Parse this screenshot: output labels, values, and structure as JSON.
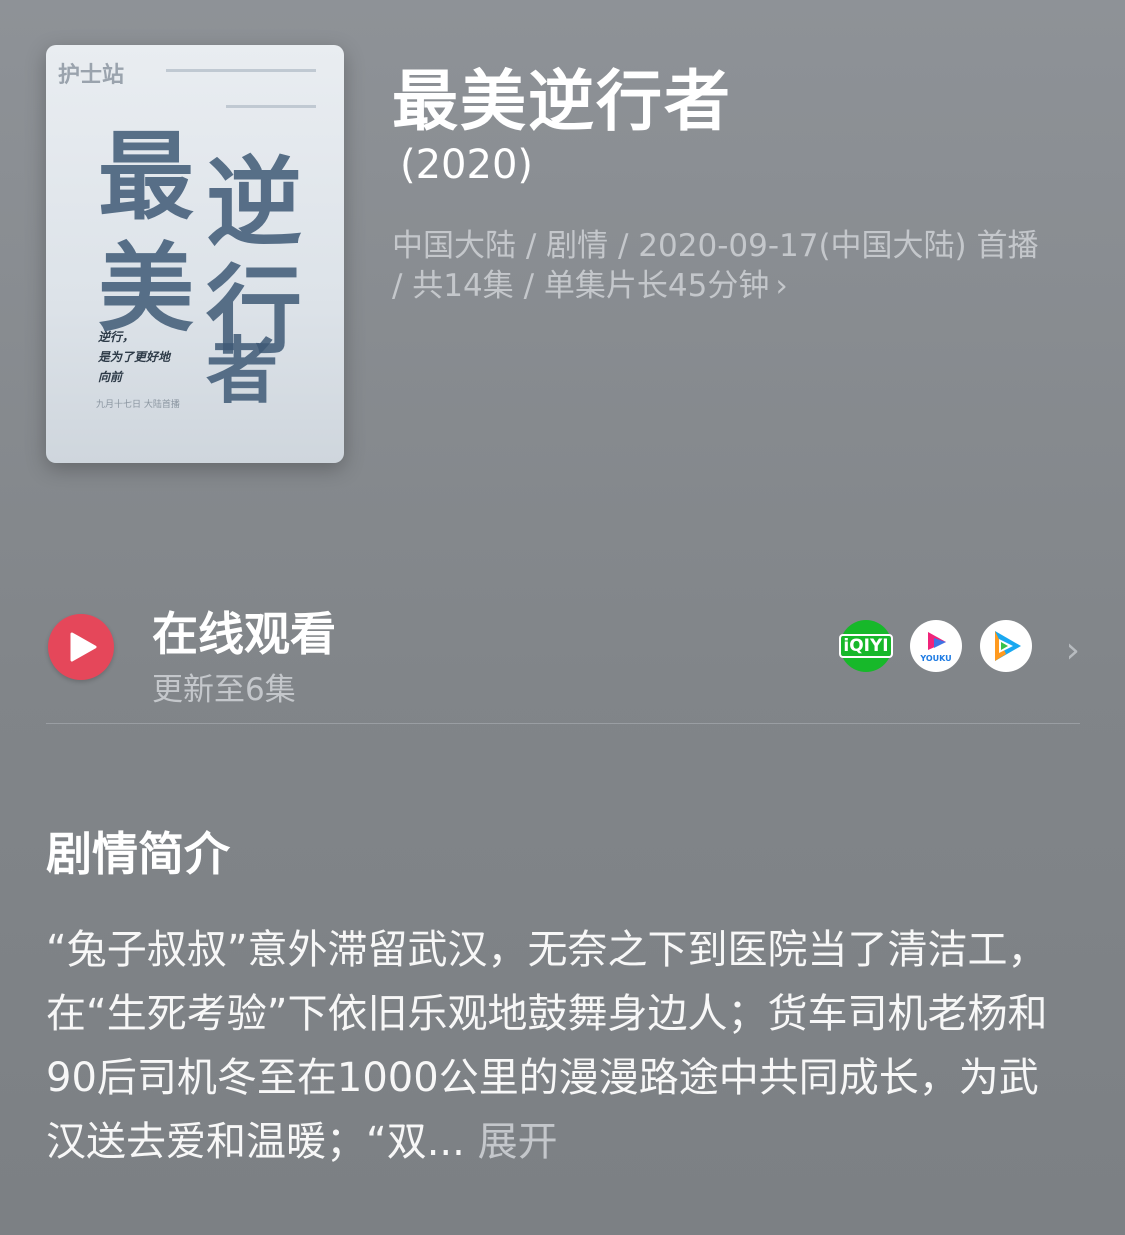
{
  "show": {
    "title": "最美逆行者",
    "year": "(2020)",
    "meta": "中国大陆 / 剧情 / 2020-09-17(中国大陆) 首播 / 共14集 / 单集片长45分钟",
    "meta_chevron": "›"
  },
  "poster": {
    "top_text": "护士站",
    "big_chars": [
      "最",
      "逆",
      "美",
      "行",
      "者"
    ],
    "tagline": "逆行，\n是为了更好地\n向前",
    "credit": "九月十七日 大陆首播"
  },
  "watch": {
    "title": "在线观看",
    "subtitle": "更新至6集",
    "platforms": [
      {
        "name": "iqiyi-icon",
        "label": "iQIYI"
      },
      {
        "name": "youku-icon",
        "label": "YOUKU"
      },
      {
        "name": "tencent-video-icon",
        "label": ""
      }
    ],
    "chevron": "›"
  },
  "synopsis": {
    "heading": "剧情简介",
    "text": "“兔子叔叔”意外滞留武汉，无奈之下到医院当了清洁工，在“生死考验”下依旧乐观地鼓舞身边人；货车司机老杨和90后司机冬至在1000公里的漫漫路途中共同成长，为武汉送去爱和温暖；“双...",
    "expand_label": "展开"
  },
  "colors": {
    "play_button": "#e5475a",
    "iqiyi": "#17b82a",
    "secondary_text": "#c4c7cb"
  }
}
